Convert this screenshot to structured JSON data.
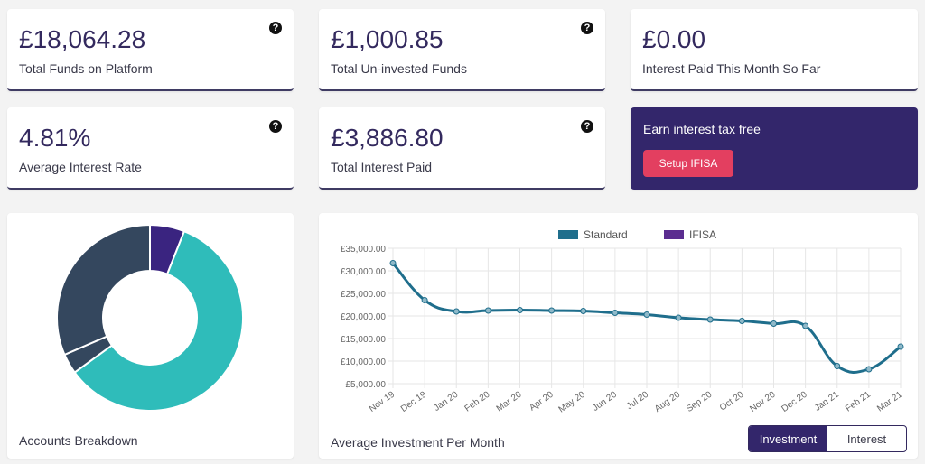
{
  "stats": [
    {
      "value": "£18,064.28",
      "label": "Total Funds on Platform",
      "help": "?"
    },
    {
      "value": "£1,000.85",
      "label": "Total Un-invested Funds",
      "help": "?"
    },
    {
      "value": "£0.00",
      "label": "Interest Paid This Month So Far"
    },
    {
      "value": "4.81%",
      "label": "Average Interest Rate",
      "help": "?"
    },
    {
      "value": "£3,886.80",
      "label": "Total Interest Paid",
      "help": "?"
    }
  ],
  "promo": {
    "title": "Earn interest tax free",
    "button": "Setup IFISA"
  },
  "accounts": {
    "title": "Accounts Breakdown"
  },
  "investment": {
    "title": "Average Investment Per Month",
    "toggle": [
      "Investment",
      "Interest"
    ],
    "active": "Investment"
  },
  "chart_data": [
    {
      "type": "pie",
      "variant": "donut",
      "values": [
        6,
        59,
        3.5,
        31.5
      ],
      "colors": [
        "#3a2480",
        "#2fbcba",
        "#34475e",
        "#34475e"
      ]
    },
    {
      "type": "line",
      "categories": [
        "Nov 19",
        "Dec 19",
        "Jan 20",
        "Feb 20",
        "Mar 20",
        "Apr 20",
        "May 20",
        "Jun 20",
        "Jul 20",
        "Aug 20",
        "Sep 20",
        "Oct 20",
        "Nov 20",
        "Dec 20",
        "Jan 21",
        "Feb 21",
        "Mar 21"
      ],
      "series": [
        {
          "name": "Standard",
          "color": "#1f6e8c",
          "values": [
            31700,
            23500,
            21000,
            21200,
            21300,
            21200,
            21100,
            20700,
            20300,
            19600,
            19200,
            18900,
            18300,
            17800,
            8900,
            8200,
            13200
          ]
        },
        {
          "name": "IFISA",
          "color": "#5b2d90",
          "values": []
        }
      ],
      "yticks": [
        "£5,000.00",
        "£10,000.00",
        "£15,000.00",
        "£20,000.00",
        "£25,000.00",
        "£30,000.00",
        "£35,000.00"
      ],
      "ylim": [
        5000,
        35000
      ],
      "grid": true,
      "legend": "top"
    }
  ]
}
